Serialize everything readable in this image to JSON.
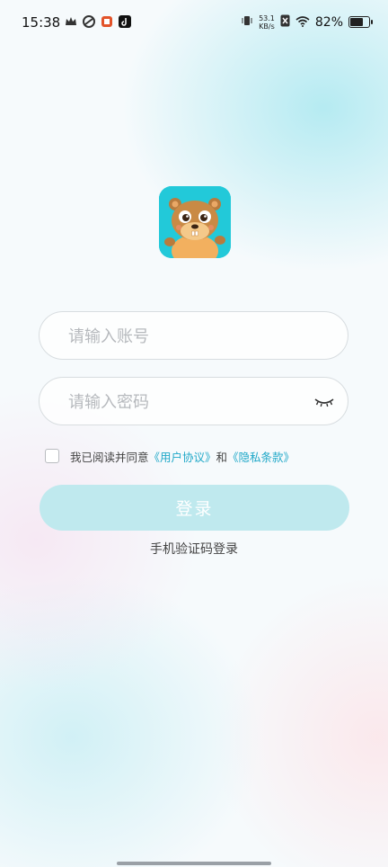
{
  "status_bar": {
    "time": "15:38",
    "net_speed_value": "53.1",
    "net_speed_unit": "KB/s",
    "battery_percent": "82%",
    "battery_level": 0.82,
    "left_icons": [
      "crown-icon",
      "app-icon",
      "app-icon",
      "tiktok-icon"
    ],
    "right_icons": [
      "vibrate-icon",
      "sim-icon",
      "wifi-icon",
      "battery-icon"
    ]
  },
  "login": {
    "account_placeholder": "请输入账号",
    "password_placeholder": "请输入密码",
    "agree_prefix": "我已阅读并同意",
    "user_agreement": "《用户协议》",
    "and": "和",
    "privacy_policy": "《隐私条款》",
    "login_button": "登录",
    "sms_login": "手机验证码登录"
  },
  "colors": {
    "accent": "#20a8c8",
    "button_disabled": "#bfe9ee",
    "logo_bg": "#22c9d9"
  }
}
